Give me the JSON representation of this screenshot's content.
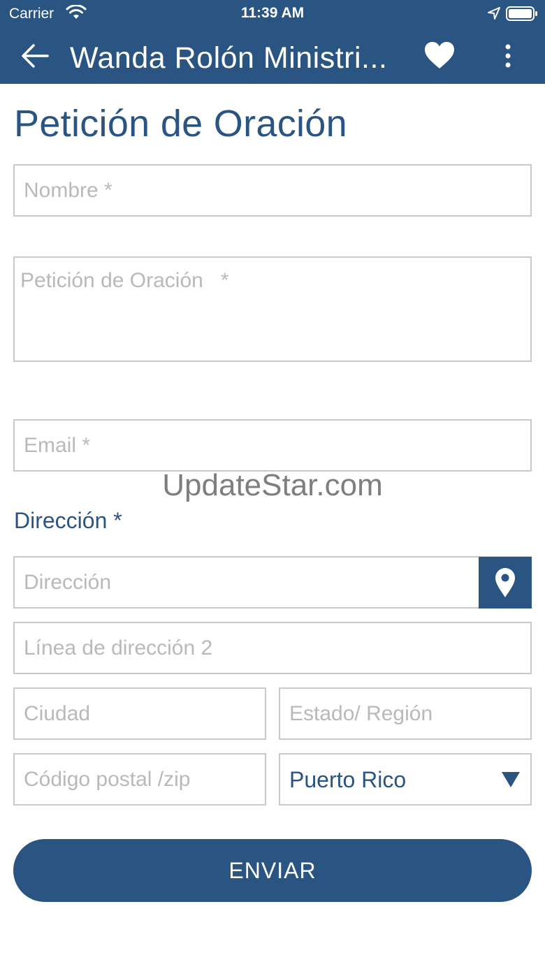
{
  "status_bar": {
    "carrier": "Carrier",
    "time": "11:39 AM"
  },
  "nav": {
    "title": "Wanda Rolón Ministri..."
  },
  "page": {
    "title": "Petición de Oración"
  },
  "form": {
    "name_placeholder": "Nombre *",
    "prayer_placeholder": "Petición de Oración   *",
    "email_placeholder": "Email *",
    "address_label": "Dirección *",
    "address_placeholder": "Dirección",
    "address2_placeholder": "Línea de dirección 2",
    "city_placeholder": "Ciudad",
    "state_placeholder": "Estado/ Región",
    "zip_placeholder": "Código postal /zip",
    "country_value": "Puerto Rico",
    "submit_label": "ENVIAR"
  },
  "watermark": "UpdateStar.com",
  "colors": {
    "brand": "#2a5582",
    "border": "#c9c9c9",
    "placeholder": "#b9b9b9"
  }
}
